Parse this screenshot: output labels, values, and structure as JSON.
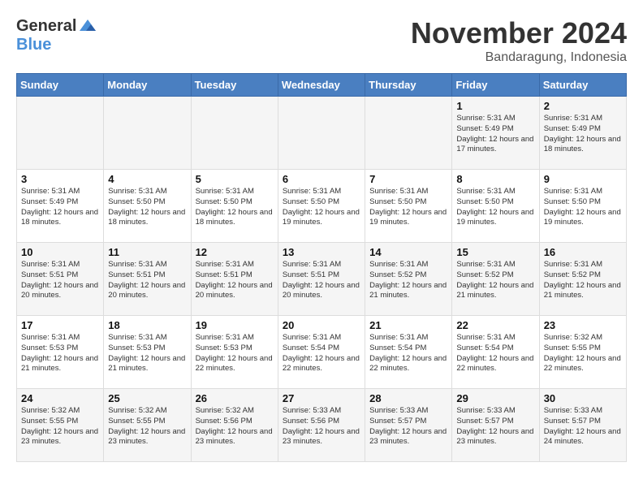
{
  "header": {
    "logo_general": "General",
    "logo_blue": "Blue",
    "month": "November 2024",
    "location": "Bandaragung, Indonesia"
  },
  "weekdays": [
    "Sunday",
    "Monday",
    "Tuesday",
    "Wednesday",
    "Thursday",
    "Friday",
    "Saturday"
  ],
  "weeks": [
    [
      {
        "day": "",
        "info": ""
      },
      {
        "day": "",
        "info": ""
      },
      {
        "day": "",
        "info": ""
      },
      {
        "day": "",
        "info": ""
      },
      {
        "day": "",
        "info": ""
      },
      {
        "day": "1",
        "info": "Sunrise: 5:31 AM\nSunset: 5:49 PM\nDaylight: 12 hours\nand 17 minutes."
      },
      {
        "day": "2",
        "info": "Sunrise: 5:31 AM\nSunset: 5:49 PM\nDaylight: 12 hours\nand 18 minutes."
      }
    ],
    [
      {
        "day": "3",
        "info": "Sunrise: 5:31 AM\nSunset: 5:49 PM\nDaylight: 12 hours\nand 18 minutes."
      },
      {
        "day": "4",
        "info": "Sunrise: 5:31 AM\nSunset: 5:50 PM\nDaylight: 12 hours\nand 18 minutes."
      },
      {
        "day": "5",
        "info": "Sunrise: 5:31 AM\nSunset: 5:50 PM\nDaylight: 12 hours\nand 18 minutes."
      },
      {
        "day": "6",
        "info": "Sunrise: 5:31 AM\nSunset: 5:50 PM\nDaylight: 12 hours\nand 19 minutes."
      },
      {
        "day": "7",
        "info": "Sunrise: 5:31 AM\nSunset: 5:50 PM\nDaylight: 12 hours\nand 19 minutes."
      },
      {
        "day": "8",
        "info": "Sunrise: 5:31 AM\nSunset: 5:50 PM\nDaylight: 12 hours\nand 19 minutes."
      },
      {
        "day": "9",
        "info": "Sunrise: 5:31 AM\nSunset: 5:50 PM\nDaylight: 12 hours\nand 19 minutes."
      }
    ],
    [
      {
        "day": "10",
        "info": "Sunrise: 5:31 AM\nSunset: 5:51 PM\nDaylight: 12 hours\nand 20 minutes."
      },
      {
        "day": "11",
        "info": "Sunrise: 5:31 AM\nSunset: 5:51 PM\nDaylight: 12 hours\nand 20 minutes."
      },
      {
        "day": "12",
        "info": "Sunrise: 5:31 AM\nSunset: 5:51 PM\nDaylight: 12 hours\nand 20 minutes."
      },
      {
        "day": "13",
        "info": "Sunrise: 5:31 AM\nSunset: 5:51 PM\nDaylight: 12 hours\nand 20 minutes."
      },
      {
        "day": "14",
        "info": "Sunrise: 5:31 AM\nSunset: 5:52 PM\nDaylight: 12 hours\nand 21 minutes."
      },
      {
        "day": "15",
        "info": "Sunrise: 5:31 AM\nSunset: 5:52 PM\nDaylight: 12 hours\nand 21 minutes."
      },
      {
        "day": "16",
        "info": "Sunrise: 5:31 AM\nSunset: 5:52 PM\nDaylight: 12 hours\nand 21 minutes."
      }
    ],
    [
      {
        "day": "17",
        "info": "Sunrise: 5:31 AM\nSunset: 5:53 PM\nDaylight: 12 hours\nand 21 minutes."
      },
      {
        "day": "18",
        "info": "Sunrise: 5:31 AM\nSunset: 5:53 PM\nDaylight: 12 hours\nand 21 minutes."
      },
      {
        "day": "19",
        "info": "Sunrise: 5:31 AM\nSunset: 5:53 PM\nDaylight: 12 hours\nand 22 minutes."
      },
      {
        "day": "20",
        "info": "Sunrise: 5:31 AM\nSunset: 5:54 PM\nDaylight: 12 hours\nand 22 minutes."
      },
      {
        "day": "21",
        "info": "Sunrise: 5:31 AM\nSunset: 5:54 PM\nDaylight: 12 hours\nand 22 minutes."
      },
      {
        "day": "22",
        "info": "Sunrise: 5:31 AM\nSunset: 5:54 PM\nDaylight: 12 hours\nand 22 minutes."
      },
      {
        "day": "23",
        "info": "Sunrise: 5:32 AM\nSunset: 5:55 PM\nDaylight: 12 hours\nand 22 minutes."
      }
    ],
    [
      {
        "day": "24",
        "info": "Sunrise: 5:32 AM\nSunset: 5:55 PM\nDaylight: 12 hours\nand 23 minutes."
      },
      {
        "day": "25",
        "info": "Sunrise: 5:32 AM\nSunset: 5:55 PM\nDaylight: 12 hours\nand 23 minutes."
      },
      {
        "day": "26",
        "info": "Sunrise: 5:32 AM\nSunset: 5:56 PM\nDaylight: 12 hours\nand 23 minutes."
      },
      {
        "day": "27",
        "info": "Sunrise: 5:33 AM\nSunset: 5:56 PM\nDaylight: 12 hours\nand 23 minutes."
      },
      {
        "day": "28",
        "info": "Sunrise: 5:33 AM\nSunset: 5:57 PM\nDaylight: 12 hours\nand 23 minutes."
      },
      {
        "day": "29",
        "info": "Sunrise: 5:33 AM\nSunset: 5:57 PM\nDaylight: 12 hours\nand 23 minutes."
      },
      {
        "day": "30",
        "info": "Sunrise: 5:33 AM\nSunset: 5:57 PM\nDaylight: 12 hours\nand 24 minutes."
      }
    ]
  ]
}
